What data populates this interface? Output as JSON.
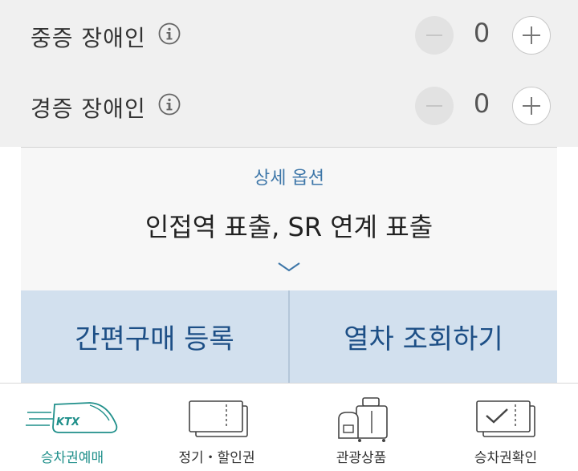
{
  "passengers": [
    {
      "label": "중증 장애인",
      "count": "0"
    },
    {
      "label": "경증 장애인",
      "count": "0"
    }
  ],
  "details": {
    "caption": "상세 옵션",
    "value": "인접역 표출, SR 연계 표출"
  },
  "actions": {
    "quick_register": "간편구매 등록",
    "search_trains": "열차 조회하기"
  },
  "tabs": [
    {
      "label": "승차권예매",
      "icon": "ktx-train-icon",
      "active": true
    },
    {
      "label": "정기・할인권",
      "icon": "ticket-icon",
      "active": false
    },
    {
      "label": "관광상품",
      "icon": "luggage-icon",
      "active": false
    },
    {
      "label": "승차권확인",
      "icon": "ticket-check-icon",
      "active": false
    }
  ],
  "colors": {
    "accent": "#3d76a8",
    "action_bar": "#d2e0ee",
    "action_text": "#1d4f86",
    "active_tab": "#1f8f8a"
  }
}
